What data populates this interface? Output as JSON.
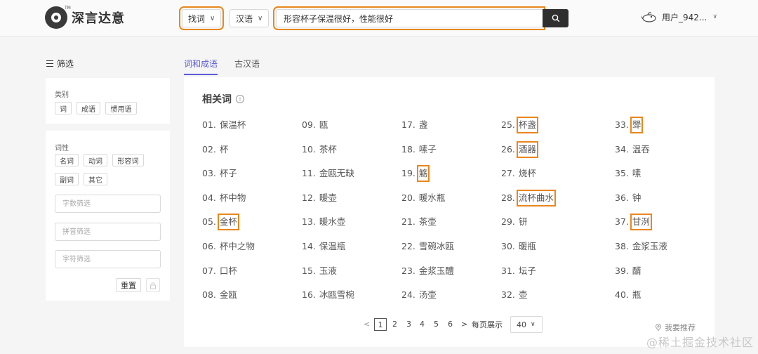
{
  "header": {
    "logo_text": "深言达意",
    "logo_tm": "TM",
    "mode_select": "找词",
    "language_select": "汉语",
    "search_value": "形容杯子保温很好，性能很好",
    "user_name": "用户_942..."
  },
  "sidebar": {
    "filter_title": "筛选",
    "category_label": "类别",
    "category_tags": [
      "词",
      "成语",
      "惯用语"
    ],
    "pos_label": "词性",
    "pos_tags": [
      "名词",
      "动词",
      "形容词",
      "副词",
      "其它"
    ],
    "char_count_placeholder": "字数筛选",
    "pinyin_placeholder": "拼音筛选",
    "char_placeholder": "字符筛选",
    "reset_label": "重置"
  },
  "tabs": [
    "词和成语",
    "古汉语"
  ],
  "results": {
    "title": "相关词",
    "info_icon": "i",
    "columns": [
      [
        {
          "num": "01.",
          "word": "保温杯"
        },
        {
          "num": "02.",
          "word": "杯"
        },
        {
          "num": "03.",
          "word": "杯子"
        },
        {
          "num": "04.",
          "word": "杯中物"
        },
        {
          "num": "05.",
          "word": "金杯"
        },
        {
          "num": "06.",
          "word": "杯中之物"
        },
        {
          "num": "07.",
          "word": "口杯"
        },
        {
          "num": "08.",
          "word": "金瓯"
        }
      ],
      [
        {
          "num": "09.",
          "word": "瓯"
        },
        {
          "num": "10.",
          "word": "茶杯"
        },
        {
          "num": "11.",
          "word": "金瓯无缺"
        },
        {
          "num": "12.",
          "word": "暖壶"
        },
        {
          "num": "13.",
          "word": "暖水壶"
        },
        {
          "num": "14.",
          "word": "保温瓶"
        },
        {
          "num": "15.",
          "word": "玉液"
        },
        {
          "num": "16.",
          "word": "冰瓯雪椀"
        }
      ],
      [
        {
          "num": "17.",
          "word": "盏"
        },
        {
          "num": "18.",
          "word": "嗉子"
        },
        {
          "num": "19.",
          "word": "觞"
        },
        {
          "num": "20.",
          "word": "暖水瓶"
        },
        {
          "num": "21.",
          "word": "茶壶"
        },
        {
          "num": "22.",
          "word": "雪碗冰瓯"
        },
        {
          "num": "23.",
          "word": "金浆玉醴"
        },
        {
          "num": "24.",
          "word": "汤壶"
        }
      ],
      [
        {
          "num": "25.",
          "word": "杯盏"
        },
        {
          "num": "26.",
          "word": "酒器"
        },
        {
          "num": "27.",
          "word": "烧杯"
        },
        {
          "num": "28.",
          "word": "流杯曲水"
        },
        {
          "num": "29.",
          "word": "钘"
        },
        {
          "num": "30.",
          "word": "暖瓶"
        },
        {
          "num": "31.",
          "word": "坛子"
        },
        {
          "num": "32.",
          "word": "壶"
        }
      ],
      [
        {
          "num": "33.",
          "word": "斝"
        },
        {
          "num": "34.",
          "word": "温吞"
        },
        {
          "num": "35.",
          "word": "嗉"
        },
        {
          "num": "36.",
          "word": "钟"
        },
        {
          "num": "37.",
          "word": "甘洌"
        },
        {
          "num": "38.",
          "word": "金浆玉液"
        },
        {
          "num": "39.",
          "word": "醑"
        },
        {
          "num": "40.",
          "word": "瓶"
        }
      ]
    ],
    "highlighted": [
      "05.",
      "19.",
      "25.",
      "26.",
      "28.",
      "33.",
      "37."
    ]
  },
  "pagination": {
    "prev": "<",
    "pages": [
      "1",
      "2",
      "3",
      "4",
      "5",
      "6"
    ],
    "current": "1",
    "next": ">",
    "per_page_label": "每页展示",
    "per_page_value": "40",
    "recommend_label": "我要推荐"
  },
  "watermark": "@稀土掘金技术社区",
  "colors": {
    "highlight": "#e8871e",
    "tab_active": "#5b5bd6",
    "search_button": "#2f2f2f"
  }
}
